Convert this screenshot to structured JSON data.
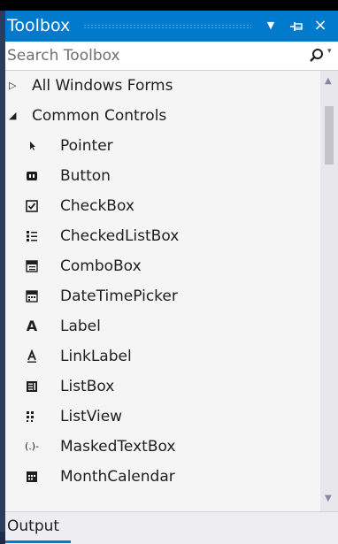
{
  "window": {
    "title": "Toolbox",
    "accent_color": "#007acc",
    "buttons": {
      "menu_icon": "dropdown-arrow-icon",
      "pin_icon": "pin-icon",
      "close_icon": "close-icon"
    }
  },
  "search": {
    "placeholder": "Search Toolbox",
    "icon": "search-icon"
  },
  "tree": {
    "groups": [
      {
        "label": "All Windows Forms",
        "expanded": false
      },
      {
        "label": "Common Controls",
        "expanded": true
      }
    ],
    "items": [
      {
        "label": "Pointer",
        "icon": "pointer-icon"
      },
      {
        "label": "Button",
        "icon": "button-icon"
      },
      {
        "label": "CheckBox",
        "icon": "checkbox-icon"
      },
      {
        "label": "CheckedListBox",
        "icon": "checkedlistbox-icon"
      },
      {
        "label": "ComboBox",
        "icon": "combobox-icon"
      },
      {
        "label": "DateTimePicker",
        "icon": "datetimepicker-icon"
      },
      {
        "label": "Label",
        "icon": "label-icon"
      },
      {
        "label": "LinkLabel",
        "icon": "linklabel-icon"
      },
      {
        "label": "ListBox",
        "icon": "listbox-icon"
      },
      {
        "label": "ListView",
        "icon": "listview-icon"
      },
      {
        "label": "MaskedTextBox",
        "icon": "maskedtextbox-icon"
      },
      {
        "label": "MonthCalendar",
        "icon": "monthcalendar-icon"
      }
    ]
  },
  "bottom_tab": {
    "label": "Output"
  }
}
